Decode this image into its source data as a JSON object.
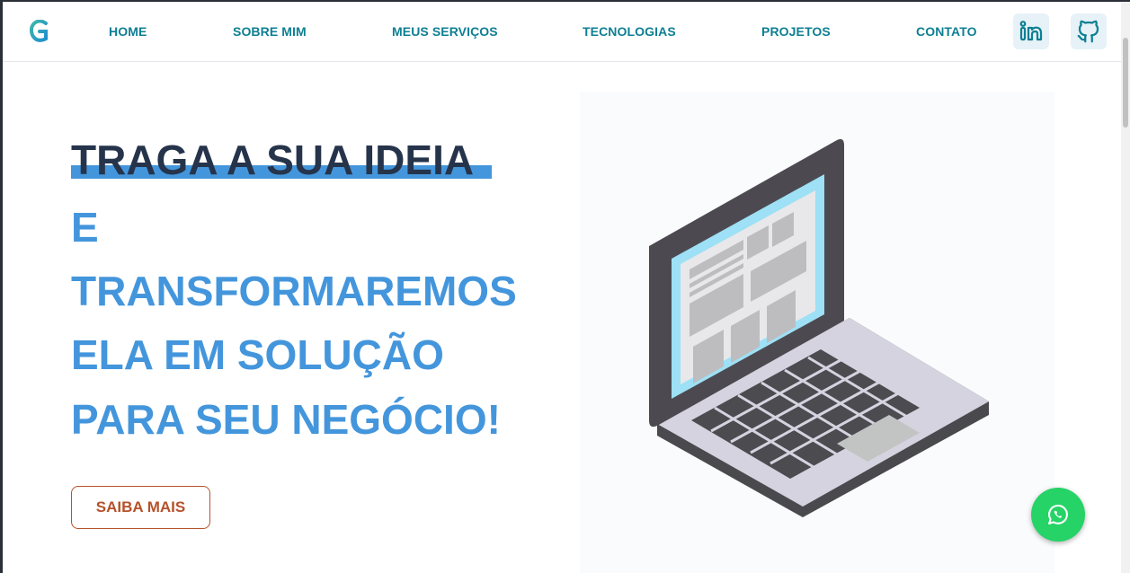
{
  "nav": {
    "items": [
      {
        "label": "HOME"
      },
      {
        "label": "SOBRE MIM"
      },
      {
        "label": "MEUS SERVIÇOS"
      },
      {
        "label": "TECNOLOGIAS"
      },
      {
        "label": "PROJETOS"
      },
      {
        "label": "CONTATO"
      }
    ],
    "social": [
      {
        "icon": "linkedin-icon"
      },
      {
        "icon": "github-icon"
      }
    ]
  },
  "hero": {
    "headline_highlight": "TRAGA A SUA IDEIA",
    "headline_lines": [
      "E",
      "TRANSFORMAREMOS",
      "ELA EM SOLUÇÃO",
      "PARA SEU NEGÓCIO!"
    ],
    "cta_label": "SAIBA MAIS"
  },
  "colors": {
    "nav_text": "#0e7f93",
    "headline_dark": "#26344b",
    "headline_blue": "#4496dc",
    "cta": "#b5522a",
    "whatsapp": "#25d366"
  }
}
